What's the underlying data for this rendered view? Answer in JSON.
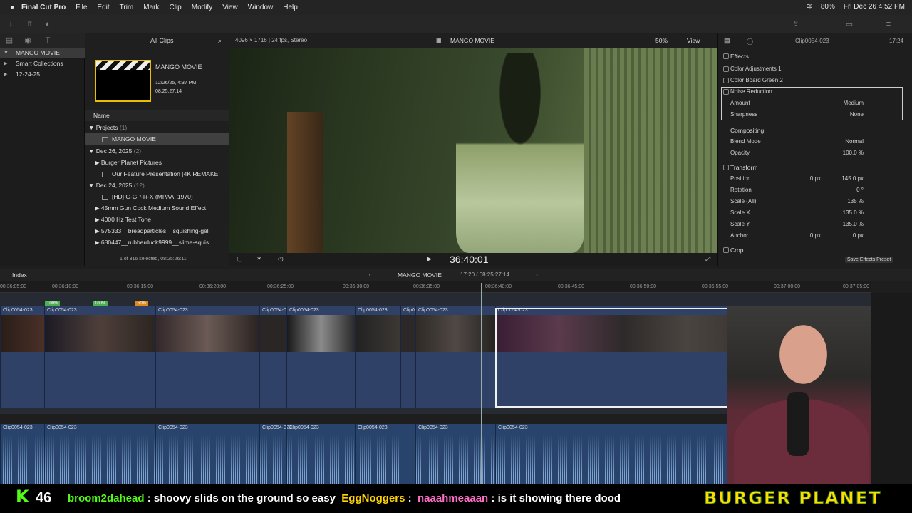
{
  "menubar": {
    "app": "Final Cut Pro",
    "items": [
      "File",
      "Edit",
      "Trim",
      "Mark",
      "Clip",
      "Modify",
      "View",
      "Window",
      "Help"
    ],
    "battery": "80%",
    "datetime": "Fri Dec 26  4:52 PM"
  },
  "browser": {
    "filter": "All Clips",
    "library": "MANGO MOVIE",
    "library_items": [
      "MANGO MOVIE",
      "Smart Collections",
      "12-24-25"
    ],
    "project_title": "MANGO MOVIE",
    "project_date": "12/26/25, 4:37 PM",
    "project_duration": "08:25:27:14",
    "column_name": "Name",
    "groups": [
      {
        "label": "Projects",
        "count": "(1)"
      },
      {
        "label": "Dec 26, 2025",
        "count": "(2)"
      },
      {
        "label": "Dec 24, 2025",
        "count": "(12)"
      }
    ],
    "rows": [
      "MANGO MOVIE",
      "Burger Planet Pictures",
      "Our Feature Presentation [4K REMAKE]",
      "[HD] G-GP-R-X (MPAA, 1970)",
      "45mm Gun Cock Medium Sound Effect",
      "4000 Hz Test Tone",
      "575333__breadparticles__squishing-gel",
      "680447__rubberduck9999__slime-squis"
    ],
    "status": "1 of 316 selected, 08:25:26:11"
  },
  "viewer": {
    "format": "4096 × 1716 | 24 fps, Stereo",
    "title": "MANGO MOVIE",
    "zoom": "50%",
    "view_label": "View",
    "timecode": "36:40:01"
  },
  "inspector": {
    "clip": "Clip0054-023",
    "duration": "17:24",
    "effects_label": "Effects",
    "effects": [
      "Color Adjustments 1",
      "Color Board Green 2"
    ],
    "noise_reduction": {
      "label": "Noise Reduction",
      "amount_label": "Amount",
      "amount": "Medium",
      "sharpness_label": "Sharpness",
      "sharpness": "None"
    },
    "compositing": {
      "label": "Compositing",
      "blend_label": "Blend Mode",
      "blend": "Normal",
      "opacity_label": "Opacity",
      "opacity": "100.0 %"
    },
    "transform": {
      "label": "Transform",
      "position_label": "Position",
      "pos_x": "0 px",
      "pos_y": "145.0 px",
      "rotation_label": "Rotation",
      "rotation": "0 °",
      "scale_all_label": "Scale (All)",
      "scale_all": "135 %",
      "scale_x_label": "Scale X",
      "scale_x": "135.0 %",
      "scale_y_label": "Scale Y",
      "scale_y": "135.0 %",
      "anchor_label": "Anchor",
      "anchor_x": "0 px",
      "anchor_y": "0 px"
    },
    "crop_label": "Crop",
    "save_button": "Save Effects Preset"
  },
  "timeline": {
    "index_label": "Index",
    "project": "MANGO MOVIE",
    "position": "17:20 / 08:25:27:14",
    "ruler": [
      "00:36:05:00",
      "00:36:10:00",
      "00:36:15:00",
      "00:36:20:00",
      "00:36:25:00",
      "00:36:30:00",
      "00:36:35:00",
      "00:36:40:00",
      "00:36:45:00",
      "00:36:50:00",
      "00:36:55:00",
      "00:37:00:00",
      "00:37:05:00"
    ],
    "clip_name": "Clip0054-023",
    "retime_badges": [
      "100%",
      "100%",
      "50%"
    ]
  },
  "stream": {
    "kick_count": "46",
    "chat": [
      {
        "user": "broom2dahead",
        "msg": "shoovy slids on the ground so easy"
      },
      {
        "user": "EggNoggers",
        "msg": ""
      },
      {
        "user": "naaahmeaaan",
        "msg": "is it showing there dood"
      }
    ],
    "overlay_text": "BURGER PLANET"
  }
}
